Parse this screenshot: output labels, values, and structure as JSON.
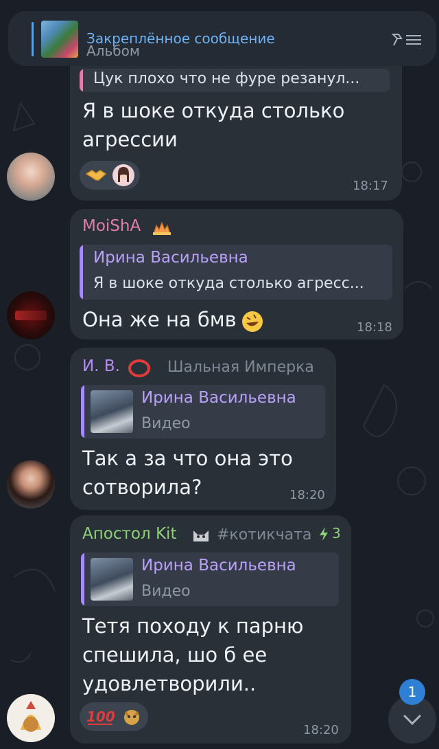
{
  "pinned": {
    "title": "Закреплённое сообщение",
    "subtitle": "Альбом"
  },
  "messages": [
    {
      "reply_text": "Цук плохо что не фуре резанул...",
      "text_lines": [
        "Я в шоке откуда столько",
        "агрессии"
      ],
      "time": "18:17",
      "reactions": [
        "handshake-emoji",
        "avatar-girl-emoji"
      ]
    },
    {
      "sender": "MoiShA",
      "sender_color": "#e07fa8",
      "reply_name": "Ирина Васильевна",
      "reply_text": "Я в шоке откуда столько агресс...",
      "text": "Она же на бмв",
      "time": "18:18"
    },
    {
      "sender": "И. В.",
      "sender_color": "#b48cf0",
      "admin_title": "Шальная Имперка",
      "reply_name": "Ирина Васильевна",
      "reply_text": "Видео",
      "text_lines": [
        "Так а за что она это",
        "сотворила?"
      ],
      "time": "18:20"
    },
    {
      "sender": "Апостол Kit",
      "sender_color": "#8fd07a",
      "tag": "#котикчата",
      "boost_count": "3",
      "reply_name": "Ирина Васильевна",
      "reply_text": "Видео",
      "text_lines": [
        "Тетя походу к парню",
        "спешила, шо б ее",
        "удовлетворили.."
      ],
      "time": "18:20",
      "reactions": [
        "hundred-emoji",
        "cat-sticker-emoji"
      ],
      "reaction_text": "100"
    }
  ],
  "scroll": {
    "unread": "1"
  },
  "colors": {
    "bubble": "#2a3038",
    "reply_accent": "#a78bfa",
    "link": "#6fb1f2"
  }
}
